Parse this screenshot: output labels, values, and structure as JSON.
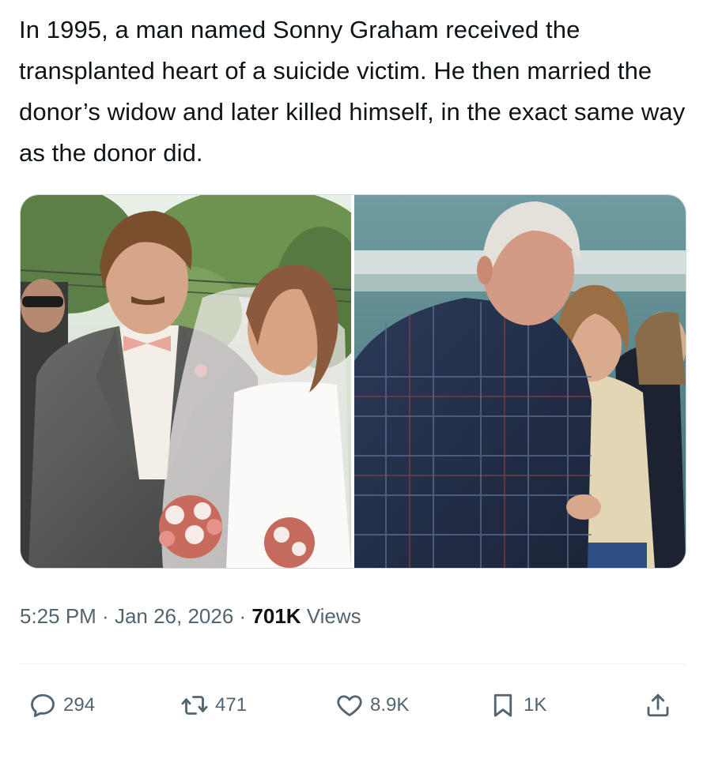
{
  "tweet": {
    "text": "In 1995, a man named Sonny Graham received the transplanted heart of a suicide victim. He then married the donor’s widow and later killed himself, in the exact same way as the donor did."
  },
  "meta": {
    "time": "5:25 PM",
    "sep1": " · ",
    "date": "Jan 26, 2026",
    "sep2": " · ",
    "views_count": "701K",
    "views_label": " Views"
  },
  "actions": {
    "replies": "294",
    "reposts": "471",
    "likes": "8.9K",
    "bookmarks": "1K"
  },
  "icons": {
    "reply": "reply-bubble-icon",
    "repost": "repost-arrows-icon",
    "like": "heart-icon",
    "bookmark": "bookmark-icon",
    "share": "share-upload-icon"
  },
  "colors": {
    "text": "#0f1419",
    "secondary": "#536471",
    "border": "#cfd9de"
  }
}
